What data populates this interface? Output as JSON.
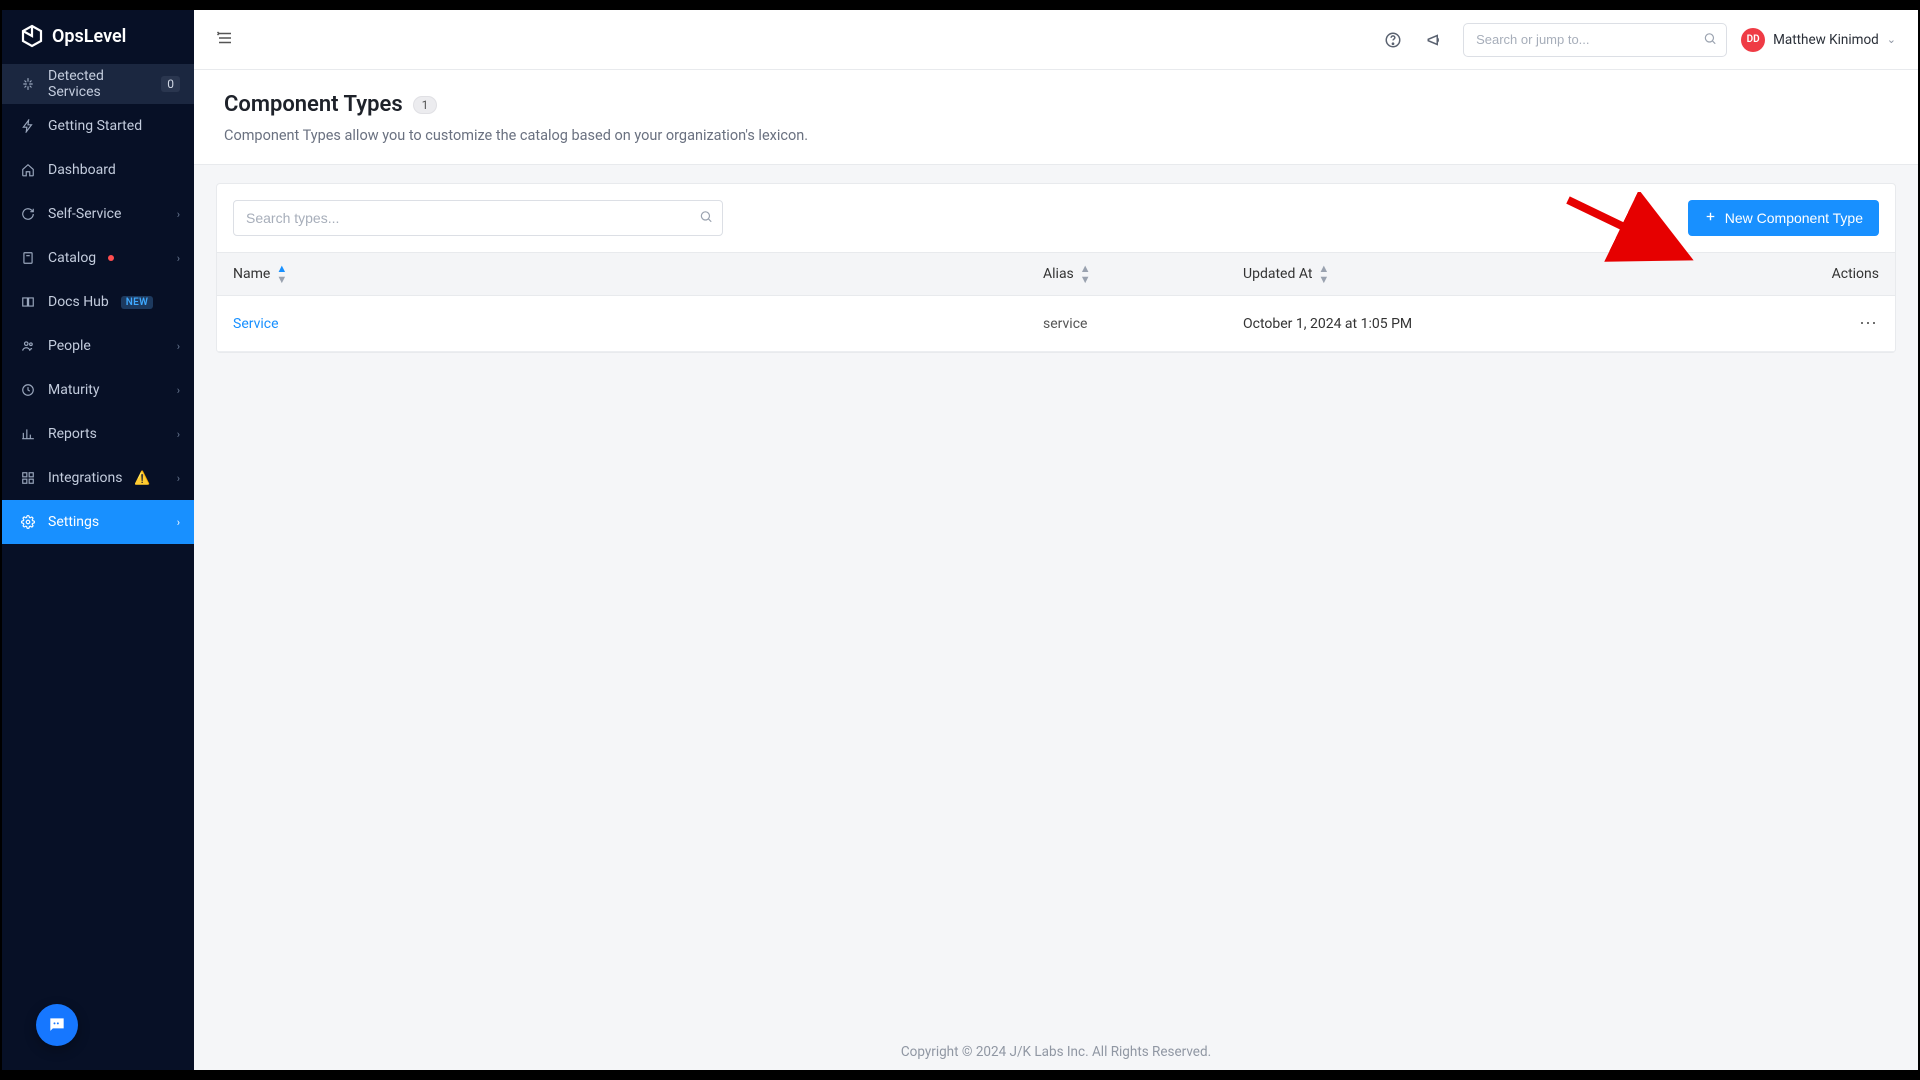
{
  "brand": {
    "name": "OpsLevel"
  },
  "sidebar": {
    "detected": {
      "label": "Detected Services",
      "count": "0"
    },
    "items": [
      {
        "label": "Getting Started"
      },
      {
        "label": "Dashboard"
      },
      {
        "label": "Self-Service"
      },
      {
        "label": "Catalog"
      },
      {
        "label": "Docs Hub",
        "tag": "NEW"
      },
      {
        "label": "People"
      },
      {
        "label": "Maturity"
      },
      {
        "label": "Reports"
      },
      {
        "label": "Integrations"
      },
      {
        "label": "Settings"
      }
    ]
  },
  "topbar": {
    "search_placeholder": "Search or jump to...",
    "avatar_initials": "DD",
    "user_name": "Matthew Kinimod"
  },
  "page": {
    "title": "Component Types",
    "count": "1",
    "description": "Component Types allow you to customize the catalog based on your organization's lexicon."
  },
  "toolbar": {
    "search_placeholder": "Search types...",
    "new_button": "New Component Type"
  },
  "table": {
    "headers": {
      "name": "Name",
      "alias": "Alias",
      "updated": "Updated At",
      "actions": "Actions"
    },
    "rows": [
      {
        "name": "Service",
        "alias": "service",
        "updated": "October 1, 2024 at 1:05 PM"
      }
    ]
  },
  "footer": {
    "text": "Copyright © 2024 J/K Labs Inc. All Rights Reserved."
  }
}
